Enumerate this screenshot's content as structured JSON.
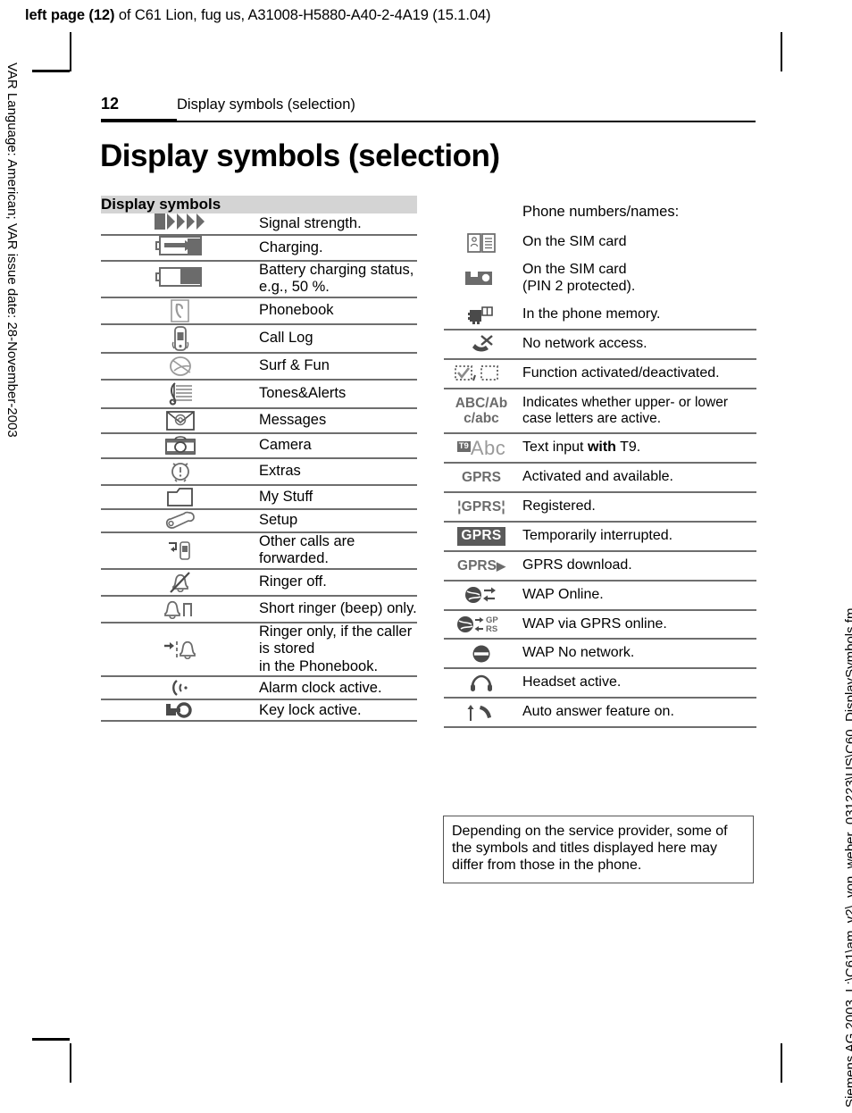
{
  "running_head": {
    "bold_prefix": "left page (12)",
    "rest": " of C61 Lion, fug us, A31008-H5880-A40-2-4A19 (15.1.04)"
  },
  "side_notes": {
    "left": "VAR Language: American; VAR issue date: 28-November-2003",
    "right": "Siemens AG 2003, L:\\C61\\am_v2\\_von_weber_031223\\US\\C60_DisplaySymbols.fm"
  },
  "header": {
    "page_number": "12",
    "chapter": "Display symbols (selection)"
  },
  "title": "Display symbols (selection)",
  "left_table": {
    "header": "Display symbols",
    "rows": [
      {
        "icon": "signal-strength-icon",
        "text": "Signal strength."
      },
      {
        "icon": "battery-charging-icon",
        "text": "Charging."
      },
      {
        "icon": "battery-level-icon",
        "text": "Battery charging status,\ne.g., 50 %."
      },
      {
        "icon": "phonebook-icon",
        "text": "Phonebook"
      },
      {
        "icon": "call-log-icon",
        "text": "Call Log"
      },
      {
        "icon": "surf-and-fun-icon",
        "text": "Surf & Fun"
      },
      {
        "icon": "tones-and-alerts-icon",
        "text": "Tones&Alerts"
      },
      {
        "icon": "messages-icon",
        "text": "Messages"
      },
      {
        "icon": "camera-icon",
        "text": "Camera"
      },
      {
        "icon": "extras-alarm-icon",
        "text": "Extras"
      },
      {
        "icon": "my-stuff-folder-icon",
        "text": "My Stuff"
      },
      {
        "icon": "setup-wrench-icon",
        "text": "Setup"
      },
      {
        "icon": "call-forward-icon",
        "text": "Other calls are forwarded."
      },
      {
        "icon": "ringer-off-icon",
        "text": "Ringer off."
      },
      {
        "icon": "short-ringer-beep-icon",
        "text": "Short ringer (beep) only."
      },
      {
        "icon": "ringer-phonebook-only-icon",
        "text": "Ringer only, if the caller is stored\nin the Phonebook."
      },
      {
        "icon": "alarm-clock-active-icon",
        "text": "Alarm clock active."
      },
      {
        "icon": "key-lock-active-icon",
        "text": "Key lock active."
      }
    ]
  },
  "right_table": {
    "intro": "Phone numbers/names:",
    "rows": [
      {
        "icon": "sim-card-contacts-icon",
        "text": "On the SIM card"
      },
      {
        "icon": "sim-card-pin2-icon",
        "text": "On the SIM card\n(PIN 2 protected)."
      },
      {
        "icon": "phone-memory-icon",
        "text": "In the phone memory."
      },
      {
        "icon": "no-network-access-icon",
        "text": "No network access."
      },
      {
        "icon": "checkbox-on-off-icon",
        "text": "Function activated/deactivated."
      },
      {
        "icon": "case-indicator-text",
        "symbol_line1": "ABC/Ab",
        "symbol_line2": "c/abc",
        "text": "Indicates whether upper- or lower case letters are active."
      },
      {
        "icon": "t9-abc-icon",
        "symbol_badge": "T9",
        "symbol_rest": "Abc",
        "text_pre": "Text input ",
        "text_bold": "with",
        "text_post": " T9."
      },
      {
        "icon": "gprs-plain-icon",
        "symbol": "GPRS",
        "text": "Activated and available."
      },
      {
        "icon": "gprs-bracketed-icon",
        "symbol": "GPRS",
        "text": "Registered."
      },
      {
        "icon": "gprs-inverted-icon",
        "symbol": "GPRS",
        "text": "Temporarily interrupted."
      },
      {
        "icon": "gprs-download-icon",
        "symbol": "GPRS",
        "text": "GPRS download."
      },
      {
        "icon": "wap-online-icon",
        "text": "WAP Online."
      },
      {
        "icon": "wap-via-gprs-icon",
        "symbol_gp": "GP",
        "symbol_rs": "RS",
        "text": "WAP via GPRS online."
      },
      {
        "icon": "wap-no-network-icon",
        "text": "WAP No network."
      },
      {
        "icon": "headset-active-icon",
        "text": "Headset active."
      },
      {
        "icon": "auto-answer-icon",
        "text": "Auto answer feature on."
      }
    ]
  },
  "note": "Depending on the service provider, some of the symbols and titles displayed here may differ from those in the phone.",
  "colors": {
    "icon_gray": "#6b6b6b",
    "header_band": "#d4d4d4",
    "rule": "#6e6e6e"
  }
}
